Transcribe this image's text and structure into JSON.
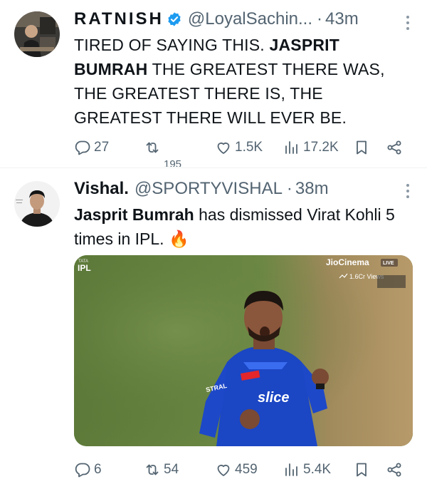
{
  "tweets": [
    {
      "name": "RATNISH",
      "handle": "@LoyalSachin...",
      "separator": "·",
      "time": "43m",
      "text_parts": [
        "TIRED OF SAYING THIS. ",
        "JASPRIT BUMRAH",
        " THE GREATEST THERE WAS, THE GREATEST THERE IS, THE GREATEST THERE WILL EVER BE."
      ],
      "verified": true,
      "actions": {
        "replies": "27",
        "retweets": "",
        "likes": "1.5K",
        "views": "17.2K"
      },
      "below_count": "195"
    },
    {
      "name": "Vishal.",
      "handle": "@SPORTYVISHAL",
      "separator": "·",
      "time": "38m",
      "text_parts": [
        "Jasprit Bumrah",
        " has dismissed Virat Kohli 5 times in IPL. ",
        "🔥"
      ],
      "media": {
        "broadcaster": "JioCinema",
        "live_badge": "LIVE",
        "views_label": "1.6Cr Views",
        "league_logo_top": "TATA",
        "league_logo": "IPL",
        "jersey_text": "slice",
        "jersey_text_side": "STRAL"
      },
      "actions": {
        "replies": "6",
        "retweets": "54",
        "likes": "459",
        "views": "5.4K"
      }
    }
  ],
  "icons": [
    "reply-icon",
    "retweet-icon",
    "like-icon",
    "views-icon",
    "bookmark-icon",
    "share-icon",
    "verified-icon",
    "more-icon"
  ],
  "colors": {
    "verified": "#1d9bf0",
    "secondary_text": "#536471",
    "text": "#0f1419"
  }
}
